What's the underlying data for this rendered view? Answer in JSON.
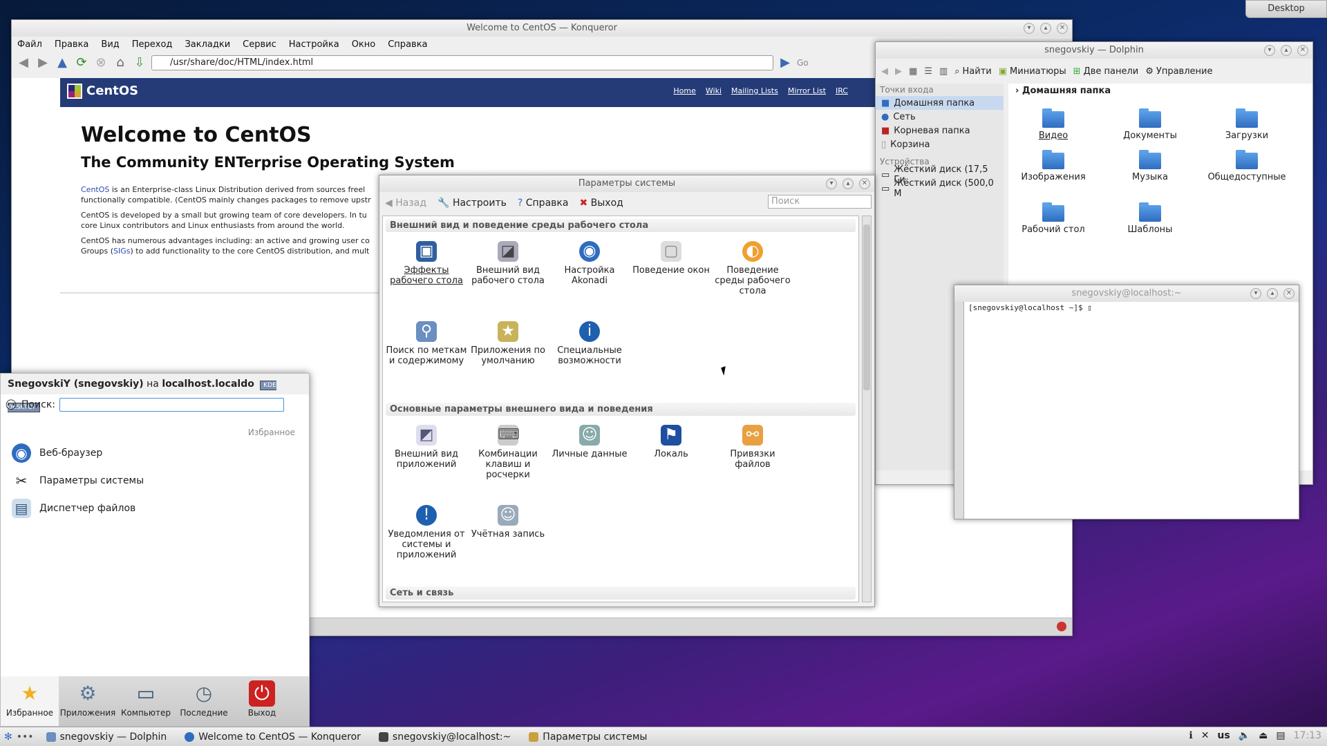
{
  "desktop_tab": "Desktop",
  "konqueror": {
    "title": "Welcome to CentOS — Konqueror",
    "menu": [
      "Файл",
      "Правка",
      "Вид",
      "Переход",
      "Закладки",
      "Сервис",
      "Настройка",
      "Окно",
      "Справка"
    ],
    "url": "/usr/share/doc/HTML/index.html",
    "go_label": "Go",
    "page": {
      "brand": "CentOS",
      "nav": [
        "Home",
        "Wiki",
        "Mailing Lists",
        "Mirror List",
        "IRC"
      ],
      "h1": "Welcome to CentOS",
      "h2": "The Community ENTerprise Operating System",
      "p1_link": "CentOS",
      "p1": " is an Enterprise-class Linux Distribution derived from sources freel",
      "p1b": "functionally compatible. (CentOS mainly changes packages to remove upstr",
      "p2": "CentOS is developed by a small but growing team of core developers.  In tu",
      "p2b": "core Linux contributors and Linux enthusiasts from around the world.",
      "p3": "CentOS has numerous advantages including: an active and growing user co",
      "p3b_pre": "Groups (",
      "p3b_link": "SIGs",
      "p3b_post": ") to add functionality to the core CentOS distribution, and mult"
    }
  },
  "dolphin": {
    "title": "snegovskiy — Dolphin",
    "toolbar": [
      "Найти",
      "Миниатюры",
      "Две панели",
      "Управление"
    ],
    "places_header": "Точки входа",
    "places": [
      "Домашняя папка",
      "Сеть",
      "Корневая папка",
      "Корзина"
    ],
    "devices_header": "Устройства",
    "devices": [
      "Жёсткий диск (17,5 Ги",
      "Жёсткий диск (500,0 М"
    ],
    "breadcrumb": "Домашняя папка",
    "folders": [
      "Видео",
      "Документы",
      "Загрузки",
      "Изображения",
      "Музыка",
      "Общедоступные",
      "Рабочий стол",
      "Шаблоны"
    ]
  },
  "terminal": {
    "title": "snegovskiy@localhost:~",
    "prompt": "[snegovskiy@localhost ~]$ ▯"
  },
  "system_settings": {
    "title": "Параметры системы",
    "toolbar": {
      "back": "Назад",
      "configure": "Настроить",
      "help": "Справка",
      "quit": "Выход"
    },
    "search_placeholder": "Поиск",
    "sections": [
      {
        "title": "Внешний вид и поведение среды рабочего стола",
        "items": [
          "Эффекты рабочего стола",
          "Внешний вид рабочего стола",
          "Настройка Akonadi",
          "Поведение окон",
          "Поведение среды рабочего стола",
          "Поиск по меткам и содержимому",
          "Приложения по умолчанию",
          "Специальные возможности"
        ]
      },
      {
        "title": "Основные параметры внешнего вида и поведения",
        "items": [
          "Внешний вид приложений",
          "Комбинации клавиш и росчерки",
          "Личные данные",
          "Локаль",
          "Привязки файлов",
          "Уведомления от системы и приложений",
          "Учётная запись"
        ]
      },
      {
        "title": "Сеть и связь",
        "items": []
      }
    ]
  },
  "kickoff": {
    "user": "SnegovskiY (snegovskiy)",
    "on": " на ",
    "host": "localhost.localdo",
    "badge": "KDE DESKTOP",
    "search_label": "Поиск:",
    "favorites_label": "Избранное",
    "favorites": [
      "Веб-браузер",
      "Параметры системы",
      "Диспетчер файлов"
    ],
    "tabs": [
      "Избранное",
      "Приложения",
      "Компьютер",
      "Последние",
      "Выход"
    ]
  },
  "taskbar": {
    "tasks": [
      "snegovskiy — Dolphin",
      "Welcome to CentOS — Konqueror",
      "snegovskiy@localhost:~",
      "Параметры системы"
    ],
    "layout": "us",
    "clock": "17:13"
  }
}
